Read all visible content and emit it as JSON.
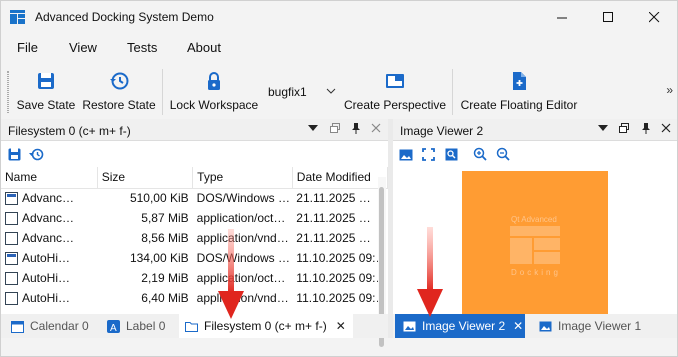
{
  "window": {
    "title": "Advanced Docking System Demo",
    "controls": [
      "minimize-icon",
      "maximize-icon",
      "close-icon"
    ]
  },
  "menu": [
    "File",
    "View",
    "Tests",
    "About"
  ],
  "toolbar": {
    "save_state": "Save State",
    "restore_state": "Restore State",
    "lock_workspace": "Lock Workspace",
    "perspective_value": "bugfix1",
    "create_perspective": "Create Perspective",
    "create_floating_editor": "Create Floating Editor",
    "more": "»"
  },
  "filesystem_pane": {
    "title": "Filesystem 0 (c+ m+ f-)",
    "columns": [
      "Name",
      "Size",
      "Type",
      "Date Modified"
    ],
    "rows": [
      {
        "name": "Advanc…",
        "size": "510,00 KiB",
        "type": "DOS/Windows …",
        "date": "21.11.2025 …",
        "icon": "exe"
      },
      {
        "name": "Advanc…",
        "size": "5,87 MiB",
        "type": "application/oct…",
        "date": "21.11.2025 …",
        "icon": "file"
      },
      {
        "name": "Advanc…",
        "size": "8,56 MiB",
        "type": "application/vnd…",
        "date": "21.11.2025 …",
        "icon": "file"
      },
      {
        "name": "AutoHi…",
        "size": "134,00 KiB",
        "type": "DOS/Windows …",
        "date": "11.10.2025 09:…",
        "icon": "exe"
      },
      {
        "name": "AutoHi…",
        "size": "2,19 MiB",
        "type": "application/oct…",
        "date": "11.10.2025 09:…",
        "icon": "file"
      },
      {
        "name": "AutoHi…",
        "size": "6,40 MiB",
        "type": "application/vnd…",
        "date": "11.10.2025 09:…",
        "icon": "file"
      }
    ]
  },
  "left_tabs": [
    {
      "label": "Calendar 0",
      "close": ""
    },
    {
      "label": "Label 0",
      "close": ""
    },
    {
      "label": "Filesystem 0 (c+ m+ f-)",
      "close": "✕"
    }
  ],
  "image_pane": {
    "title": "Image Viewer 2",
    "logo_text_1": "Qt Advanced",
    "logo_text_2": "Docking"
  },
  "right_tabs": [
    {
      "label": "Image Viewer 2",
      "close": "✕"
    },
    {
      "label": "Image Viewer 1",
      "close": ""
    }
  ],
  "colors": {
    "accent": "#1b6ac9",
    "image_bg": "#ff9c33",
    "arrow": "#e0261e"
  }
}
